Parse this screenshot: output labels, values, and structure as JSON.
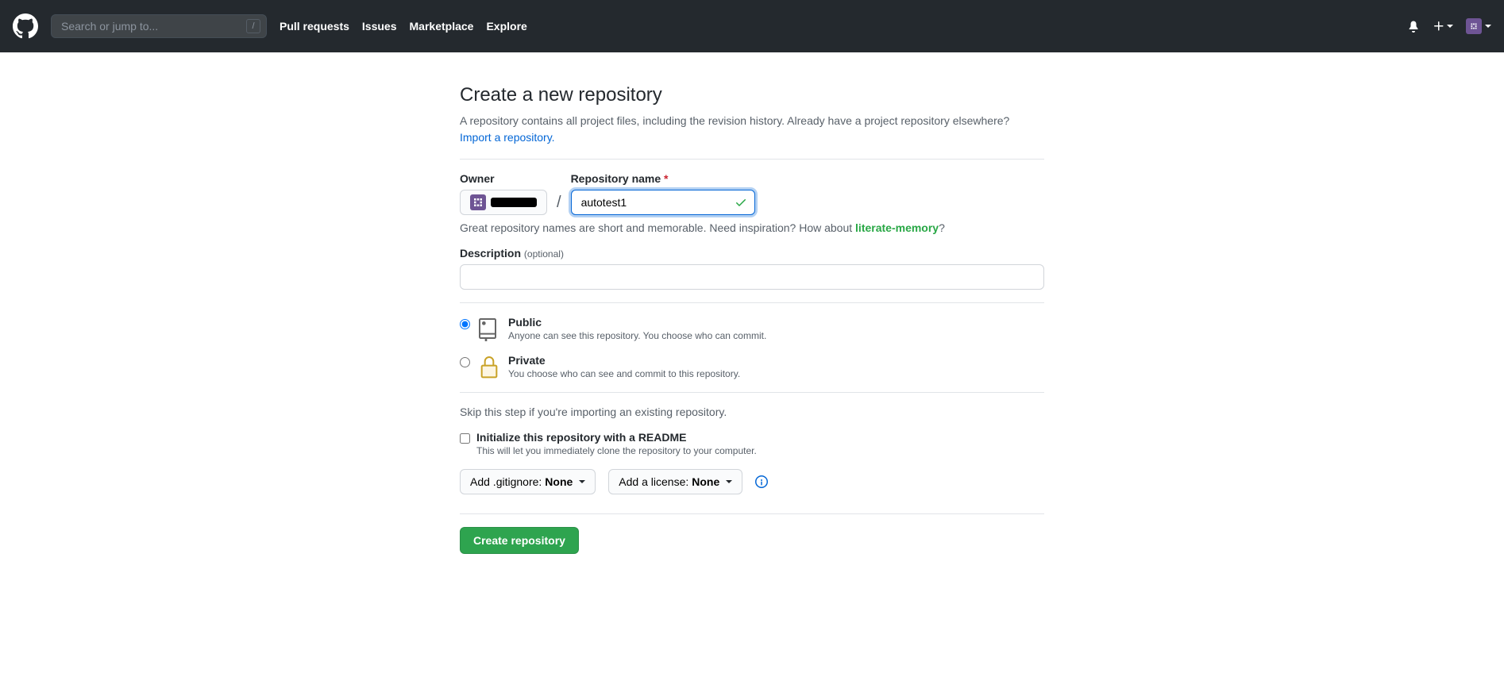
{
  "header": {
    "search_placeholder": "Search or jump to...",
    "slash_key": "/",
    "nav": {
      "pull_requests": "Pull requests",
      "issues": "Issues",
      "marketplace": "Marketplace",
      "explore": "Explore"
    }
  },
  "page": {
    "title": "Create a new repository",
    "subtitle": "A repository contains all project files, including the revision history. Already have a project repository elsewhere? ",
    "import_link": "Import a repository."
  },
  "form": {
    "owner_label": "Owner",
    "repo_label": "Repository name",
    "repo_name_value": "autotest1",
    "hint_prefix": "Great repository names are short and memorable. Need inspiration? How about ",
    "hint_suggestion": "literate-memory",
    "hint_suffix": "?",
    "desc_label": "Description",
    "desc_optional": "(optional)",
    "desc_value": "",
    "visibility": {
      "public_label": "Public",
      "public_note": "Anyone can see this repository. You choose who can commit.",
      "private_label": "Private",
      "private_note": "You choose who can see and commit to this repository."
    },
    "skip_note": "Skip this step if you're importing an existing repository.",
    "readme_label": "Initialize this repository with a README",
    "readme_note": "This will let you immediately clone the repository to your computer.",
    "gitignore_prefix": "Add .gitignore: ",
    "gitignore_value": "None",
    "license_prefix": "Add a license: ",
    "license_value": "None",
    "submit_label": "Create repository"
  }
}
